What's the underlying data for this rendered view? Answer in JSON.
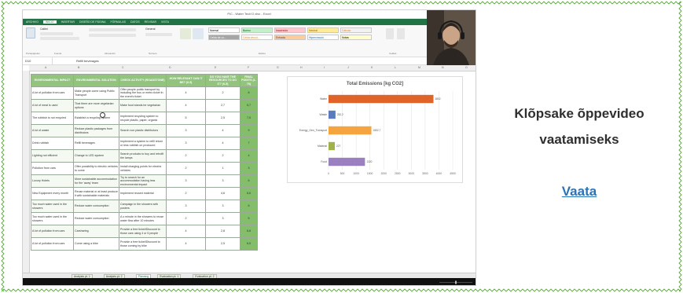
{
  "window": {
    "title": "PiC - Water Tech'O.xlsx - Excel"
  },
  "ribbon": {
    "tabs": [
      "ARCHIVO",
      "INICIO",
      "INSERTAR",
      "DISEÑO DE PÁGINA",
      "FÓRMULAS",
      "DATOS",
      "REVISAR",
      "VISTA"
    ],
    "active_tab": "INICIO",
    "font_name": "Calibri",
    "number_format": "General",
    "style_names": [
      "Normal",
      "Bueno",
      "Incorrecto",
      "Neutral",
      "Cálculo",
      "Celda de co...",
      "Celda vincul...",
      "Entrada",
      "Hipervínculo",
      "Notas"
    ],
    "group_labels": [
      "Portapapeles",
      "Fuente",
      "Alineación",
      "Número",
      "Estilos",
      "Celdas"
    ]
  },
  "formula_bar": {
    "name_box": "D10",
    "content": "Refill beverages"
  },
  "table": {
    "headers": [
      "ENVIRONMENTAL IMPACT",
      "ENVIRONMENTAL SOLUTION",
      "CHECK ACTIVITY (ROADSTONE)",
      "HOW RELEVANT CAN IT BE? (0-5)",
      "DO YOU HAVE THE RESOURCES TO DO IT? (0-5)",
      "FINAL POINTS (1-70)"
    ],
    "rows": [
      [
        "A lot of pollution from cars",
        "Make people come using Public Transport",
        "Offer people public transport by including the bus or metro ticket in the event's ticket",
        "4",
        "2",
        "8"
      ],
      [
        "A lot of meat is used",
        "That there are more vegetarian options",
        "Make food stands be vegetarian",
        "4",
        "2,7",
        "5,7"
      ],
      [
        "The rubbish is not recycled",
        "Establish a recycling system",
        "Implement recycling system to recycle plastic, paper, organic",
        "5",
        "2,5",
        "7,5"
      ],
      [
        "A lot of waste",
        "Reduce plastic packages from distributors",
        "Search non plastic distributors",
        "3",
        "4",
        "9"
      ],
      [
        "Drink rubbish",
        "Refill beverages",
        "Implement a system to refill return or less rubbish on produced",
        "3",
        "4",
        "7"
      ],
      [
        "Lighting not efficient",
        "Change to LED system",
        "Search products to buy and retrofit the lamps",
        "2",
        "2",
        "4"
      ],
      [
        "Pollution from cars",
        "Offer possibility to electric vehicles to come",
        "Install charging points for electric vehicles",
        "2",
        "1",
        "3"
      ],
      [
        "Luxury Hotels",
        "More sustainable accommodation for the 'away' team",
        "Try to search for an accommodation having less environmental impact",
        "3",
        "3",
        "6"
      ],
      [
        "New Equipment every month",
        "Reuse material or at least produce it with sustainable materials",
        "Implement reused material",
        "2",
        "4,6",
        "6,6"
      ],
      [
        "Too much water used in the showers",
        "Reduce water consumption",
        "Campaign in the showers with posters",
        "3",
        "3",
        "6"
      ],
      [
        "Too much water used in the showers",
        "Reduce water consumption",
        "A o minute in the showers to reuse water flow after 10 minutes",
        "2",
        "3",
        "5"
      ],
      [
        "A lot of pollution from cars",
        "Carsharing",
        "Provide a free ticket/Discount to those cars using 4 or 5 people",
        "4",
        "2,8",
        "6,8"
      ],
      [
        "A lot of pollution from cars",
        "Come using a bike",
        "Provide a free ticket/Discount to those coming by bike",
        "4",
        "2,5",
        "6,5"
      ]
    ]
  },
  "chart_data": {
    "type": "bar",
    "orientation": "horizontal",
    "title": "Total Emissions [kg CO2]",
    "categories": [
      "Water",
      "Waste",
      "Energy_Gen_Transport",
      "Material",
      "Food"
    ],
    "values": [
      3802,
      252.2,
      1552.7,
      227,
      1320
    ],
    "value_labels": [
      "3802",
      "252,2",
      "1552,7",
      "227",
      "1320"
    ],
    "colors": [
      "#e0632a",
      "#5b7bc0",
      "#f4a540",
      "#9fb24a",
      "#9a7fc1"
    ],
    "ticks": [
      "0",
      "500",
      "1000",
      "1500",
      "2000",
      "2500",
      "3000",
      "3500",
      "4000",
      "4500"
    ],
    "xlim": [
      0,
      4500
    ],
    "grid": true,
    "legend": "none"
  },
  "sheet_tabs": [
    {
      "label": "Analysis pt. 1",
      "active": false
    },
    {
      "label": "Analysis pt. 2",
      "active": false
    },
    {
      "label": "Planning",
      "active": true
    },
    {
      "label": "Evaluation pt. 1",
      "active": false
    },
    {
      "label": "Evaluation pt. 2",
      "active": false
    }
  ],
  "sidebar": {
    "message": "Klõpsake õppevideo vaatamiseks",
    "link_label": "Vaata"
  },
  "colors": {
    "excel_green": "#217346",
    "header_green": "#92c47d",
    "total_green": "#84be6a",
    "link_blue": "#2a73b8",
    "frame_green": "#5ea642"
  }
}
